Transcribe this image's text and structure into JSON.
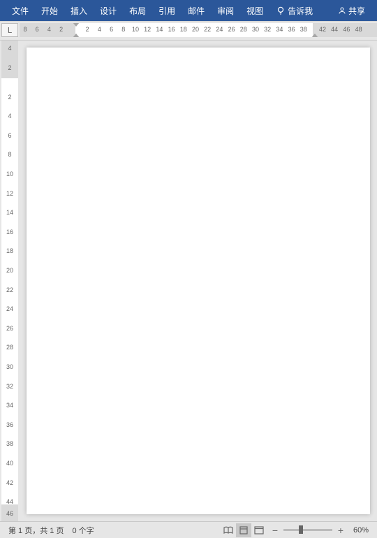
{
  "ribbon": {
    "tabs": [
      {
        "label": "文件"
      },
      {
        "label": "开始"
      },
      {
        "label": "插入"
      },
      {
        "label": "设计"
      },
      {
        "label": "布局"
      },
      {
        "label": "引用"
      },
      {
        "label": "邮件"
      },
      {
        "label": "审阅"
      },
      {
        "label": "视图"
      }
    ],
    "tell_me": "告诉我",
    "share": "共享"
  },
  "ruler": {
    "corner": "L",
    "h_margin_left_nums": [
      "8",
      "6",
      "4",
      "2"
    ],
    "h_active_nums": [
      "2",
      "4",
      "6",
      "8",
      "10",
      "12",
      "14",
      "16",
      "18",
      "20",
      "22",
      "24",
      "26",
      "28",
      "30",
      "32",
      "34",
      "36",
      "38"
    ],
    "h_margin_right_nums": [
      "42",
      "44",
      "46",
      "48"
    ],
    "v_margin_top_nums": [
      "4",
      "2"
    ],
    "v_active_nums": [
      "2",
      "4",
      "6",
      "8",
      "10",
      "12",
      "14",
      "16",
      "18",
      "20",
      "22",
      "24",
      "26",
      "28",
      "30",
      "32",
      "34",
      "36",
      "38",
      "40",
      "42",
      "44"
    ],
    "v_margin_bottom_nums": [
      "46"
    ]
  },
  "status": {
    "page_info": "第 1 页，共 1 页",
    "word_count": "0 个字",
    "zoom": "60%"
  }
}
